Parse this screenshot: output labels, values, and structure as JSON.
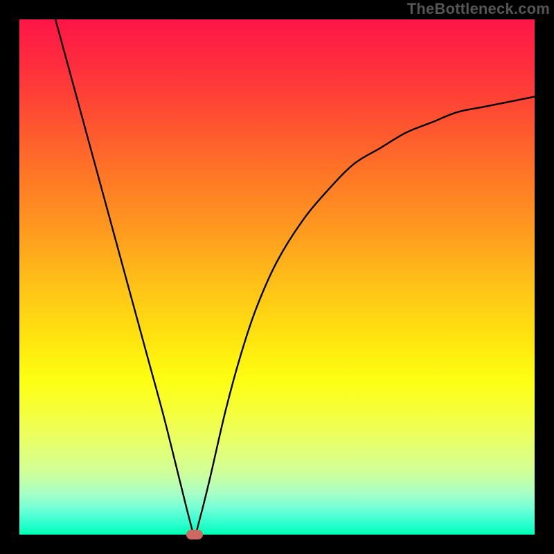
{
  "chart_data": {
    "type": "line",
    "watermark": "TheBottleneck.com",
    "title": "",
    "xlabel": "",
    "ylabel": "",
    "x_range": [
      0,
      100
    ],
    "y_range": [
      0,
      100
    ],
    "colors": {
      "curve": "#000000",
      "background_top": "#ff1547",
      "background_bottom": "#00ffb4",
      "marker": "#cb6a63",
      "frame": "#000000"
    },
    "minimum": {
      "x": 34,
      "y": 0
    },
    "series": [
      {
        "name": "bottleneck-percentage",
        "x": [
          7,
          10,
          13,
          16,
          19,
          22,
          25,
          28,
          31,
          33,
          34,
          35,
          37,
          40,
          43,
          46,
          50,
          55,
          60,
          65,
          70,
          75,
          80,
          85,
          90,
          95,
          100
        ],
        "y": [
          100,
          89,
          78,
          67,
          56,
          45,
          34,
          23,
          11,
          3,
          0,
          3,
          11,
          24,
          35,
          44,
          53,
          61,
          67,
          72,
          75,
          78,
          80,
          82,
          83,
          84,
          85
        ]
      }
    ]
  }
}
